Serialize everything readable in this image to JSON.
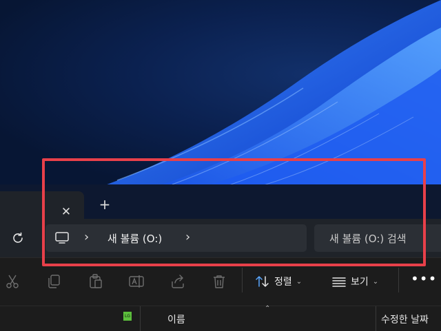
{
  "tabs": {
    "close_icon": "close-icon",
    "close_glyph": "✕",
    "new_tab_glyph": "+",
    "new_tab_icon": "plus-icon"
  },
  "navbar": {
    "refresh_icon": "refresh-icon",
    "address": {
      "root_icon": "computer-icon",
      "separator_glyph": "›",
      "current_location": "새 볼륨 (O:)"
    },
    "search_placeholder": "새 볼륨 (O:) 검색"
  },
  "toolbar": {
    "icons": [
      "cut-icon",
      "copy-icon",
      "paste-icon",
      "rename-icon",
      "share-icon",
      "delete-icon"
    ],
    "sort_label": "정렬",
    "view_label": "보기",
    "caret_glyph": "⌄",
    "more_glyph": "•••"
  },
  "file_list": {
    "header_name": "이름",
    "header_modified": "수정한 날짜",
    "sort_caret": "⌃",
    "small_icon_text": "LG"
  },
  "colors": {
    "highlight": "#e8404a",
    "panel": "#1f2329",
    "tab_bar": "#0d1830",
    "accent_icon": "#5cbf3c"
  }
}
